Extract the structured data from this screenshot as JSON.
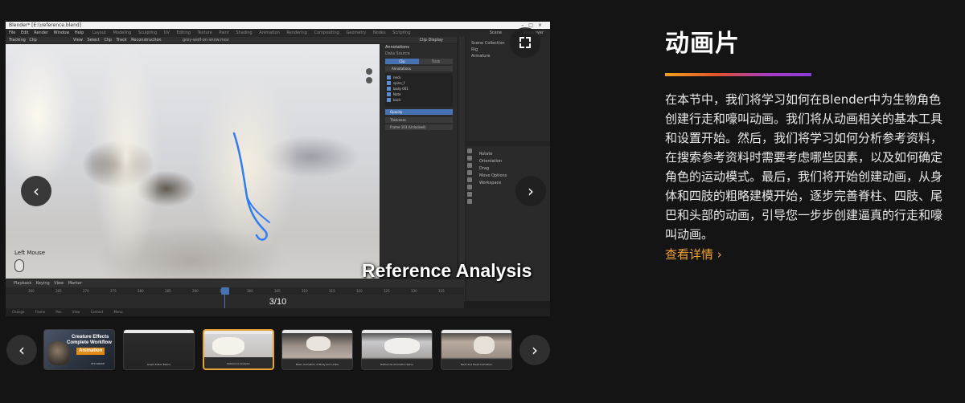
{
  "viewer": {
    "window_title": "Blender* [E:\\\\reference.blend]",
    "menu": "File  Edit  Render  Window  Help",
    "workspaces": "Layout  Modeling  Sculpting  UV Editing  Texture Paint  Shading  Animation  Rendering  Compositing  Geometry Nodes  Scripting",
    "scene": "Scene",
    "view_layer": "ViewLayer",
    "editor_mode": "Tracking  Clip",
    "editor_menu": "View  Select  Clip  Track  Reconstruction",
    "clip_file": "grey-wolf-on-snow.mov",
    "clip_display": "Clip Display",
    "mouse_label": "Left Mouse",
    "caption": "Reference Analysis",
    "npanel": {
      "title": "Annotations",
      "sub": "Data Source",
      "toggle_on": "Clip",
      "toggle_off": "Track",
      "layer_row": "Annotations",
      "layers": [
        "neck",
        "spine_f",
        "body 001",
        "Note",
        "back"
      ],
      "opacity_label": "Opacity",
      "thickness_label": "Thickness",
      "frame_field": "Frame 103 (Unlocked)"
    },
    "outliner": [
      "Scene Collection",
      "Rig",
      "Armature"
    ],
    "props": [
      "Rotate",
      "Orientation",
      "Drag",
      "Move Options",
      "Workspace"
    ],
    "timeline_bar": "Playback  Keying  View  Marker",
    "ruler_ticks": [
      "260",
      "265",
      "270",
      "275",
      "280",
      "285",
      "290",
      "295",
      "300",
      "305",
      "310",
      "315",
      "320",
      "325",
      "330",
      "335"
    ],
    "counter": "3/10",
    "status": "Change Frame  Pan View  Context Menu"
  },
  "thumbnails": [
    {
      "line1": "Creature Effects",
      "line2": "Complete Workflow",
      "badge": "Animation",
      "logo": "VFX GRACE",
      "caption": ""
    },
    {
      "caption": "Graph Editor Basics"
    },
    {
      "caption": "Reference Analysis"
    },
    {
      "caption": "Basic Animation of Body and Limbs"
    },
    {
      "caption": "Refine the Animation Spine"
    },
    {
      "caption": "Neck and Head Animation"
    }
  ],
  "content": {
    "title": "动画片",
    "description": "在本节中，我们将学习如何在Blender中为生物角色创建行走和嚎叫动画。我们将从动画相关的基本工具和设置开始。然后，我们将学习如何分析参考资料，在搜索参考资料时需要考虑哪些因素，以及如何确定角色的运动模式。最后，我们将开始创建动画，从身体和四肢的粗略建模开始，逐步完善脊柱、四肢、尾巴和头部的动画，引导您一步步创建逼真的行走和嚎叫动画。",
    "more_label": "查看详情 ›"
  },
  "colors": {
    "accent_orange": "#f0a23a",
    "active_border": "#e6a33a",
    "blender_blue": "#4772b3"
  }
}
